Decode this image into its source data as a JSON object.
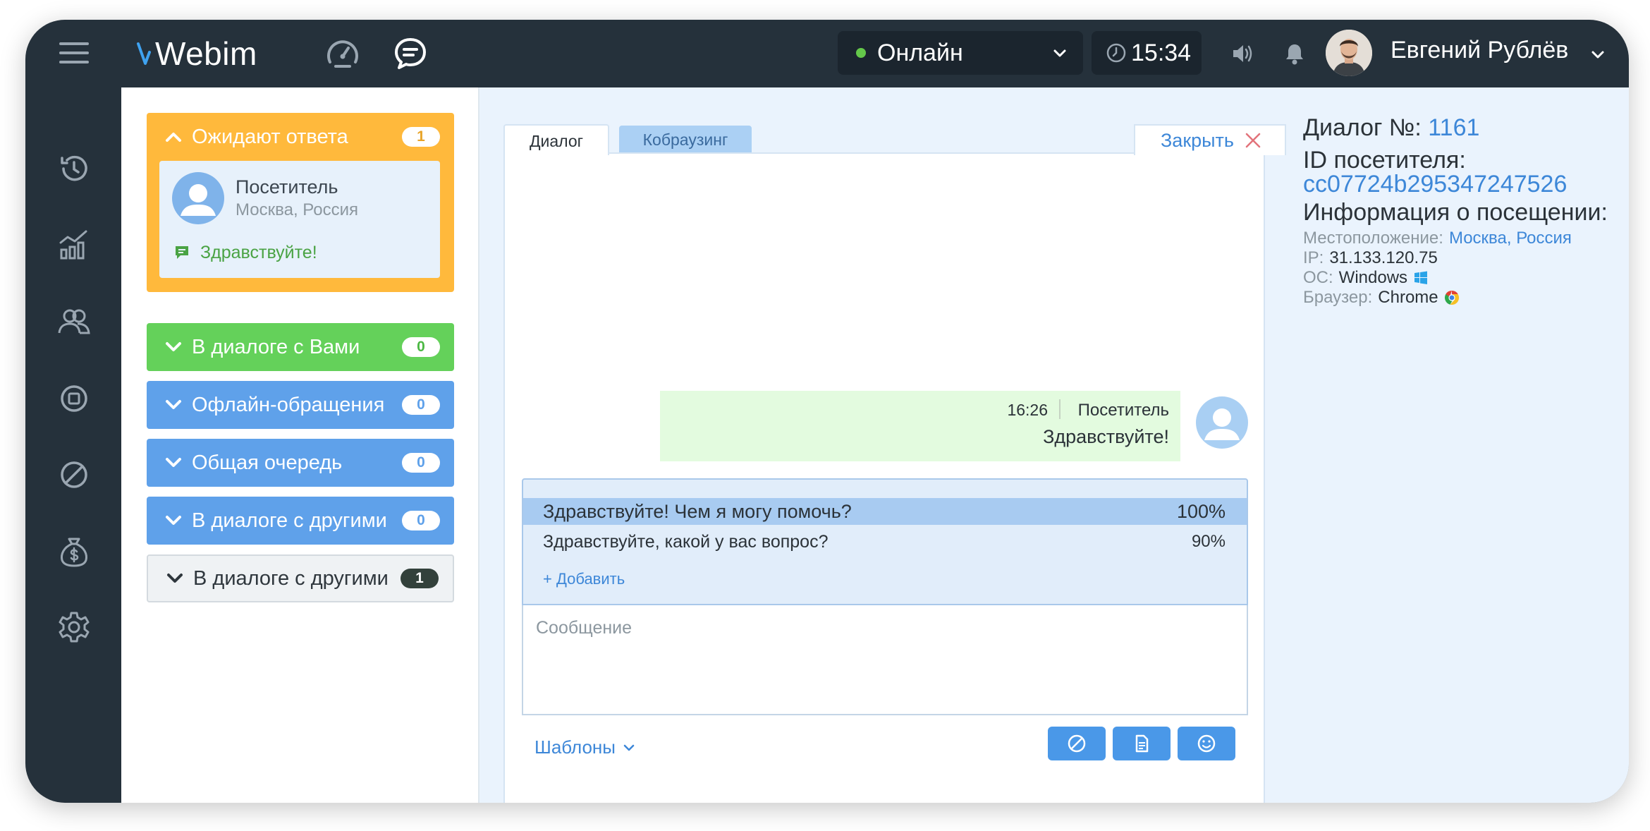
{
  "app": {
    "logo": "Webim",
    "status": {
      "label": "Онлайн",
      "color": "#64c84a"
    },
    "clock": "15:34",
    "user_name": "Евгений Рублёв"
  },
  "queue": {
    "waiting": {
      "title": "Ожидают ответа",
      "count": "1",
      "visitor": {
        "name": "Посетитель",
        "location": "Москва, Россия",
        "last_message": "Здравствуйте!"
      }
    },
    "groups": [
      {
        "title": "В диалоге с Вами",
        "count": "0",
        "color": "#64d15a"
      },
      {
        "title": "Офлайн-обращения",
        "count": "0",
        "color": "#5fa1ea"
      },
      {
        "title": "Общая очередь",
        "count": "0",
        "color": "#5fa1ea"
      },
      {
        "title": "В диалоге с другими",
        "count": "0",
        "color": "#5fa1ea"
      },
      {
        "title": "В диалоге с другими",
        "count": "1",
        "color": "#eff2f4"
      }
    ]
  },
  "chat": {
    "tabs": [
      {
        "label": "Диалог",
        "active": true
      },
      {
        "label": "Кобраузинг",
        "active": false
      }
    ],
    "close_label": "Закрыть",
    "message": {
      "time": "16:26",
      "author": "Посетитель",
      "text": "Здравствуйте!"
    },
    "suggestions": [
      {
        "text": "Здравствуйте! Чем я могу помочь?",
        "score": "100%"
      },
      {
        "text": "Здравствуйте, какой у вас вопрос?",
        "score": "90%"
      }
    ],
    "add_label": "+  Добавить",
    "input_placeholder": "Сообщение",
    "templates_label": "Шаблоны"
  },
  "info": {
    "dialog_label": "Диалог №:",
    "dialog_number": "1161",
    "visitor_id_label": "ID посетителя:",
    "visitor_id": "cc07724b295347247526",
    "visit_info_label": "Информация о посещении:",
    "location_label": "Местоположение:",
    "location": "Москва, Россия",
    "ip_label": "IP:",
    "ip": "31.133.120.75",
    "os_label": "ОС:",
    "os": "Windows",
    "browser_label": "Браузер:",
    "browser": "Chrome"
  }
}
